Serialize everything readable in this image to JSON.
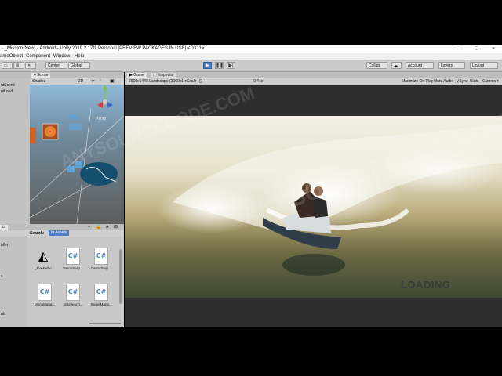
{
  "window": {
    "title": "- _Mission(New) - Android - Unity 2019.2.17f1 Personal [PREVIEW PACKAGES IN USE] <DX11>",
    "controls": [
      "–",
      "□",
      "×"
    ]
  },
  "menu": [
    "ameObject",
    "Component",
    "Window",
    "Help"
  ],
  "toolbar": {
    "pivot": "Center",
    "space": "Global",
    "collab": "Collab",
    "account": "Account",
    "layers": "Layers",
    "layout": "Layout"
  },
  "scene": {
    "tab": "Scene",
    "shading": "Shaded",
    "mode": "2D",
    "persp": "Persp"
  },
  "hierarchy": {
    "items": [
      "ntScene",
      "ntLoad"
    ]
  },
  "project": {
    "tab": "ts",
    "search_label": "Search:",
    "search_scope": "In Assets",
    "tree": [
      "oller",
      "s",
      "",
      "als"
    ],
    "assets": [
      {
        "label": "_Rocketbo",
        "type": "unity"
      },
      {
        "label": "DemoSwip...",
        "type": "C#"
      },
      {
        "label": "DemoSwip...",
        "type": "C#"
      },
      {
        "label": "MenuMana...",
        "type": "C#"
      },
      {
        "label": "SimpleAch...",
        "type": "C#"
      },
      {
        "label": "SwipeMana...",
        "type": "C#"
      }
    ]
  },
  "game": {
    "tab": "Game",
    "inspector_tab": "Inspector",
    "resolution": "2960x1440 Landscape (2960x1 ▾",
    "scale_label": "Scale",
    "scale_value": "0.44x",
    "maximize": "Maximize On Play",
    "mute": "Mute Audio",
    "vsync": "VSync",
    "stats": "Stats",
    "gizmos": "Gizmos ▾",
    "loading_text": "LOADING"
  },
  "watermarks": [
    "ANYSOURCECODE.COM",
    "ANYSOURCECODE.COM"
  ]
}
